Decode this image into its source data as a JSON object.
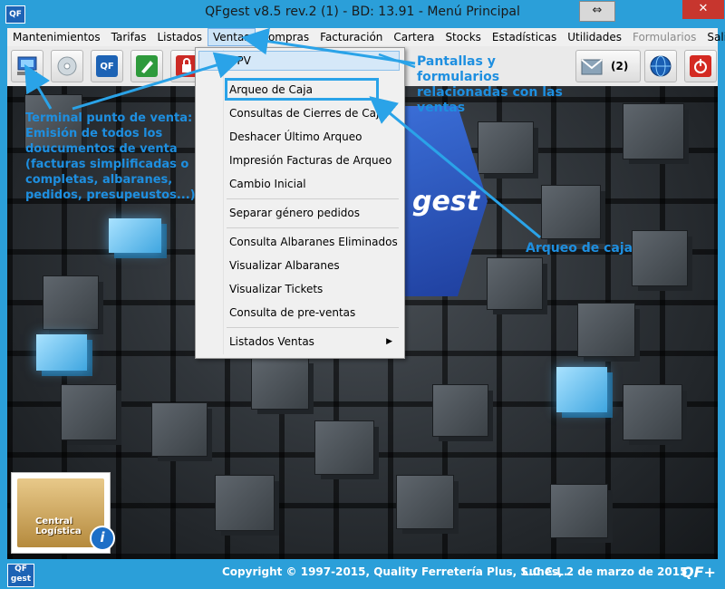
{
  "window": {
    "logo_text": "QF",
    "logo_subtext": "gest",
    "title": "QFgest v8.5 rev.2 (1) - BD: 13.91 -  Menú Principal",
    "restore_symbol": "⇔",
    "min_symbol": "—",
    "max_symbol": "□",
    "close_symbol": "✕"
  },
  "menubar": {
    "items": [
      {
        "label": "Mantenimientos"
      },
      {
        "label": "Tarifas"
      },
      {
        "label": "Listados"
      },
      {
        "label": "Ventas"
      },
      {
        "label": "Compras"
      },
      {
        "label": "Facturación"
      },
      {
        "label": "Cartera"
      },
      {
        "label": "Stocks"
      },
      {
        "label": "Estadísticas"
      },
      {
        "label": "Utilidades"
      },
      {
        "label": "Formularios"
      },
      {
        "label": "Salir"
      }
    ]
  },
  "toolbar": {
    "message_count": "(2)",
    "buttons": [
      {
        "icon": "terminal-icon"
      },
      {
        "icon": "disk-icon"
      },
      {
        "icon": "info-qfgest-icon"
      },
      {
        "icon": "pen-icon"
      },
      {
        "icon": "lock-icon"
      },
      {
        "icon": "messages-icon"
      },
      {
        "icon": "globe-icon"
      },
      {
        "icon": "power-icon"
      }
    ]
  },
  "dropdown": {
    "items": [
      {
        "label": "TPV"
      },
      {
        "label": "Arqueo de Caja"
      },
      {
        "label": "Consultas de Cierres de Caja"
      },
      {
        "label": "Deshacer Último Arqueo"
      },
      {
        "label": "Impresión Facturas de Arqueo"
      },
      {
        "label": "Cambio Inicial"
      },
      {
        "label": "Separar género pedidos"
      },
      {
        "label": "Consulta Albaranes Eliminados"
      },
      {
        "label": "Visualizar Albaranes"
      },
      {
        "label": "Visualizar Tickets"
      },
      {
        "label": "Consulta de pre-ventas"
      },
      {
        "label": "Listados Ventas"
      }
    ],
    "submenu_arrow": "▶"
  },
  "background": {
    "brand_text": "gest"
  },
  "logo_box": {
    "line1": "Central",
    "line2": "Logística",
    "info": "i"
  },
  "annotations": {
    "pantallas": "Pantallas y formularios relacionadas con las ventas",
    "terminal": "Terminal punto de venta: Emisión de todos los doucumentos de venta (facturas simplificadas o completas, albaranes, pedidos, presupeustos...)",
    "arqueo": "Arqueo de caja",
    "color": "#2aa3e8"
  },
  "statusbar": {
    "logo_text": "QF",
    "logo_subtext": "gest",
    "copyright": "Copyright © 1997-2015, Quality Ferretería Plus, S.C.C.L.",
    "date": "Lunes, 2 de marzo de 2015",
    "brand": "QF+"
  }
}
